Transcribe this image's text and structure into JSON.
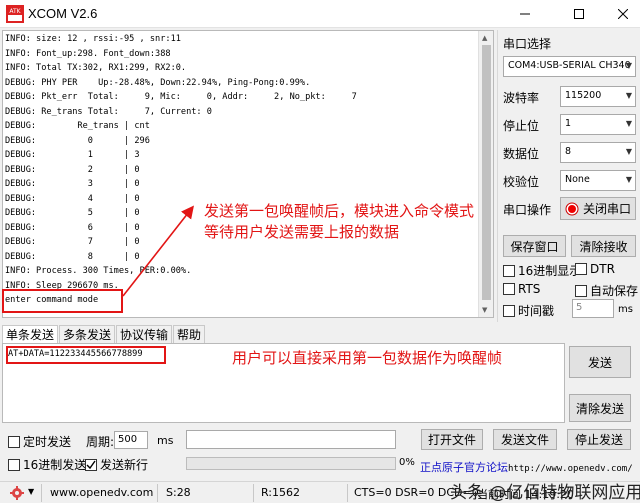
{
  "window": {
    "title": "XCOM V2.6",
    "logo_text": "ATK"
  },
  "receive": {
    "lines": [
      "INFO: size: 12 , rssi:-95 , snr:11",
      "INFO: Font_up:298. Font_down:388",
      "INFO: Total TX:302, RX1:299, RX2:0.",
      "DEBUG: PHY PER    Up:-28.48%, Down:22.94%, Ping-Pong:0.99%.",
      "DEBUG: Pkt_err  Total:     9, Mic:     0, Addr:     2, No_pkt:     7",
      "DEBUG: Re_trans Total:     7, Current: 0",
      "DEBUG:        Re_trans | cnt",
      "DEBUG:          0      | 296",
      "DEBUG:          1      | 3",
      "DEBUG:          2      | 0",
      "DEBUG:          3      | 0",
      "DEBUG:          4      | 0",
      "DEBUG:          5      | 0",
      "DEBUG:          6      | 0",
      "DEBUG:          7      | 0",
      "DEBUG:          8      | 0",
      "INFO: Process. 300 Times, PER:0.00%.",
      "INFO: Sleep 296670 ms.",
      "enter command mode"
    ]
  },
  "annotations": {
    "first_line": "发送第一包唤醒帧后，模块进入命令模式",
    "second_line": "等待用户发送需要上报的数据",
    "send_note": "用户可以直接采用第一包数据作为唤醒帧"
  },
  "serial": {
    "section_title": "串口选择",
    "port": "COM4:USB-SERIAL CH340",
    "baud_label": "波特率",
    "baud": "115200",
    "stop_label": "停止位",
    "stop": "1",
    "data_label": "数据位",
    "data": "8",
    "parity_label": "校验位",
    "parity": "None",
    "op_label": "串口操作",
    "close_btn": "关闭串口",
    "save_btn": "保存窗口",
    "clear_recv_btn": "清除接收",
    "hex_show": "16进制显示",
    "dtr": "DTR",
    "rts": "RTS",
    "auto_save": "自动保存",
    "timestamp": "时间戳",
    "timestamp_value": "5",
    "timestamp_unit": "ms"
  },
  "tabs": [
    "单条发送",
    "多条发送",
    "协议传输",
    "帮助"
  ],
  "send": {
    "text": "AT+DATA=112233445566778899",
    "send_btn": "发送",
    "clear_btn": "清除发送",
    "timed_send": "定时发送",
    "period_label": "周期:",
    "period_value": "500",
    "period_unit": "ms",
    "open_file_btn": "打开文件",
    "send_file_btn": "发送文件",
    "stop_send_btn": "停止发送",
    "hex_send": "16进制发送",
    "newline": "发送新行",
    "progress_text": "0%",
    "progress_value": 0,
    "link_text": "正点原子官方论坛",
    "link_url": "http://www.openedv.com/"
  },
  "status": {
    "url": "www.openedv.com",
    "sent": "S:28",
    "received": "R:1562",
    "signals": "CTS=0 DSR=0 DCD=0",
    "time": "当前时间 14:19:20"
  },
  "watermark": "头条 @亿佰特物联网应用"
}
